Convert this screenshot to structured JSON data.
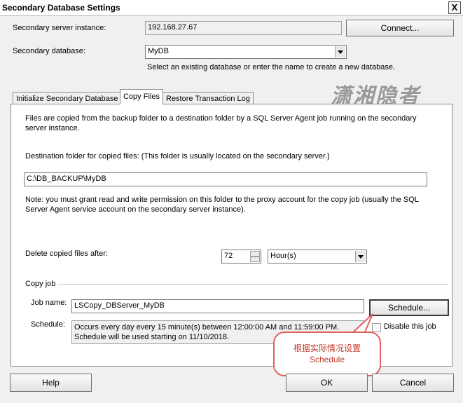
{
  "window": {
    "title": "Secondary Database Settings",
    "close_glyph": "X"
  },
  "server": {
    "label": "Secondary server instance:",
    "value": "192.168.27.67",
    "connect_button": "Connect..."
  },
  "database": {
    "label": "Secondary database:",
    "value": "MyDB",
    "hint": "Select an existing database or enter the name to create a new database."
  },
  "tabs": [
    {
      "label": "Initialize Secondary Database",
      "active": false
    },
    {
      "label": "Copy Files",
      "active": true
    },
    {
      "label": "Restore Transaction Log",
      "active": false
    }
  ],
  "watermark": "潇湘隐者",
  "copy_files": {
    "intro": "Files are copied from the backup folder to a destination folder by a SQL Server Agent job running on the secondary server instance.",
    "dest_label": "Destination folder for copied files: (This folder is usually located on the secondary server.)",
    "dest_value": "C:\\DB_BACKUP\\MyDB",
    "note": "Note: you must grant read and write permission on this folder to the proxy account for the copy job (usually the SQL Server Agent service account on the secondary server instance).",
    "delete_label": "Delete copied files after:",
    "delete_value": "72",
    "delete_unit": "Hour(s)",
    "copy_job_header": "Copy job",
    "job_name_label": "Job name:",
    "job_name_value": "LSCopy_DBServer_MyDB",
    "schedule_button": "Schedule...",
    "schedule_label": "Schedule:",
    "schedule_text": "Occurs every day every 15 minute(s) between 12:00:00 AM and 11:59:00 PM. Schedule will be used starting on 11/10/2018.",
    "disable_label": "Disable this job",
    "disable_checked": false
  },
  "callout": {
    "line1": "根据实际情况设置",
    "line2": "Schedule"
  },
  "footer": {
    "help": "Help",
    "ok": "OK",
    "cancel": "Cancel"
  }
}
